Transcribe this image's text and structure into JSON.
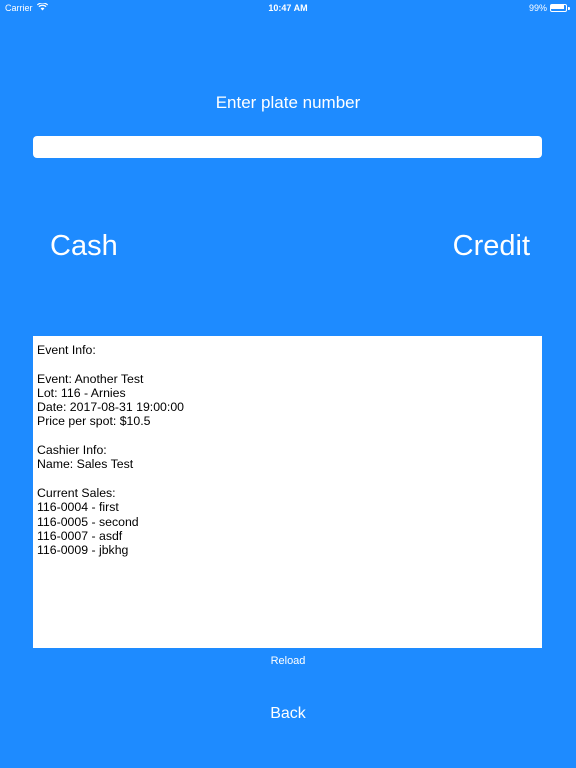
{
  "status_bar": {
    "carrier": "Carrier",
    "time": "10:47 AM",
    "battery_percent": "99%",
    "battery_level": 0.99,
    "wifi_icon": "wifi-icon",
    "battery_icon": "battery-icon"
  },
  "plate": {
    "label": "Enter plate number",
    "value": "",
    "placeholder": ""
  },
  "actions": {
    "cash_label": "Cash",
    "credit_label": "Credit"
  },
  "info": {
    "lines": [
      "Event Info:",
      "",
      "Event: Another Test",
      "Lot: 116 - Arnies",
      "Date: 2017-08-31 19:00:00",
      "Price per spot: $10.5",
      "",
      "Cashier Info:",
      "Name: Sales Test",
      "",
      "Current Sales:",
      "116-0004 - first",
      "116-0005 - second",
      "116-0007 - asdf",
      "116-0009 - jbkhg"
    ]
  },
  "footer": {
    "reload_label": "Reload",
    "back_label": "Back"
  },
  "colors": {
    "background": "#1E8BFF",
    "text": "#FFFFFF",
    "panel": "#FFFFFF"
  }
}
